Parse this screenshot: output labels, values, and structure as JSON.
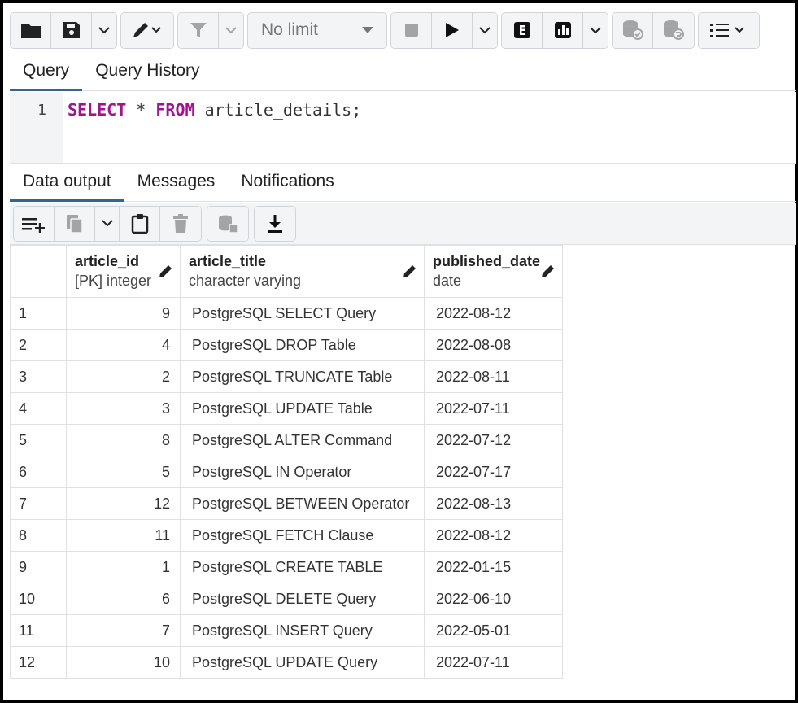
{
  "toolbar": {
    "limit_label": "No limit",
    "icons": [
      "folder-icon",
      "save-icon",
      "chevron-down-icon",
      "pen-icon",
      "filter-icon",
      "stop-icon",
      "play-icon",
      "explain-icon",
      "explain-analyze-icon",
      "commit-icon",
      "rollback-icon",
      "macros-icon"
    ]
  },
  "query_tabs": [
    {
      "label": "Query",
      "active": true
    },
    {
      "label": "Query History",
      "active": false
    }
  ],
  "editor": {
    "line_number": "1",
    "kw_select": "SELECT",
    "mid": " * ",
    "kw_from": "FROM",
    "rest": " article_details;"
  },
  "output_tabs": [
    {
      "label": "Data output",
      "active": true
    },
    {
      "label": "Messages",
      "active": false
    },
    {
      "label": "Notifications",
      "active": false
    }
  ],
  "table": {
    "columns": [
      {
        "name": "article_id",
        "type": "[PK] integer"
      },
      {
        "name": "article_title",
        "type": "character varying"
      },
      {
        "name": "published_date",
        "type": "date"
      }
    ],
    "rows": [
      {
        "n": "1",
        "id": "9",
        "title": "PostgreSQL SELECT Query",
        "date": "2022-08-12"
      },
      {
        "n": "2",
        "id": "4",
        "title": "PostgreSQL DROP Table",
        "date": "2022-08-08"
      },
      {
        "n": "3",
        "id": "2",
        "title": "PostgreSQL TRUNCATE Table",
        "date": "2022-08-11"
      },
      {
        "n": "4",
        "id": "3",
        "title": "PostgreSQL UPDATE Table",
        "date": "2022-07-11"
      },
      {
        "n": "5",
        "id": "8",
        "title": "PostgreSQL ALTER Command",
        "date": "2022-07-12"
      },
      {
        "n": "6",
        "id": "5",
        "title": "PostgreSQL IN Operator",
        "date": "2022-07-17"
      },
      {
        "n": "7",
        "id": "12",
        "title": "PostgreSQL BETWEEN Operator",
        "date": "2022-08-13"
      },
      {
        "n": "8",
        "id": "11",
        "title": "PostgreSQL FETCH Clause",
        "date": "2022-08-12"
      },
      {
        "n": "9",
        "id": "1",
        "title": "PostgreSQL CREATE TABLE",
        "date": "2022-01-15"
      },
      {
        "n": "10",
        "id": "6",
        "title": "PostgreSQL DELETE Query",
        "date": "2022-06-10"
      },
      {
        "n": "11",
        "id": "7",
        "title": "PostgreSQL INSERT Query",
        "date": "2022-05-01"
      },
      {
        "n": "12",
        "id": "10",
        "title": "PostgreSQL UPDATE Query",
        "date": "2022-07-11"
      }
    ]
  }
}
